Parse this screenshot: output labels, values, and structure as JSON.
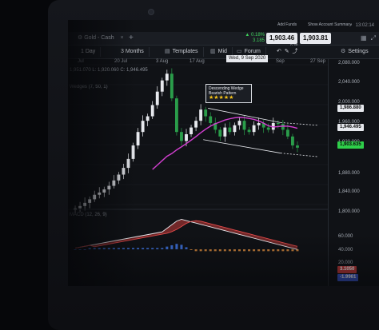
{
  "status": {
    "time": "13:02:14"
  },
  "tab": {
    "label": "Gold - Cash",
    "close": "×",
    "add": "+"
  },
  "quote": {
    "change_pct": "▲ 0.18%",
    "change_abs": "3.185",
    "bid": "1,903.46",
    "ask": "1,903.81",
    "spread": "0.35",
    "add_funds": "Add Funds",
    "summary": "Show Account Summary"
  },
  "toolbar": {
    "timeframe": "1 Day",
    "range": "3 Months",
    "templates": "Templates",
    "mid": "Mid",
    "forum": "Forum",
    "settings": "Settings"
  },
  "xaxis": {
    "labels": [
      "Jul",
      "20 Jul",
      "3 Aug",
      "17 Aug",
      "31",
      "Sep",
      "27 Sep"
    ],
    "crosshair": "Wed, 9 Sep 2020"
  },
  "legend": {
    "ohlc": "1,951.070  L: 1,920.060  C: 1,946.495",
    "indicator": "Wedges (7, 50, 1)",
    "macd": "MACD (12, 26, 9)"
  },
  "annotation": {
    "line1": "Descending Wedge",
    "line2": "Bearish Pattern",
    "stars": "★★★★★"
  },
  "yaxis": {
    "labels": [
      "2,080.000",
      "2,040.000",
      "2,000.000",
      "1,960.000",
      "1,920.000",
      "1,880.000",
      "1,840.000",
      "1,800.000"
    ],
    "tag_high": "1,986.880",
    "tag_close": "1,946.495",
    "tag_price": "1,903.635",
    "macd_labels": [
      "60.000",
      "40.000",
      "20.000"
    ],
    "macd_tag_1": "3.1050",
    "macd_tag_2": "-1.9961"
  },
  "colors": {
    "up": "#e7e9ee",
    "down": "#2a9d4a",
    "ma": "#d23fd0",
    "wedge": "#e7e9ee",
    "macd_red": "#c23a3a"
  },
  "chart_data": {
    "type": "candlestick",
    "ylim": [
      1780,
      2090
    ],
    "closes": [
      1770,
      1775,
      1782,
      1790,
      1800,
      1805,
      1812,
      1820,
      1832,
      1845,
      1860,
      1880,
      1910,
      1940,
      1965,
      1975,
      2000,
      2030,
      2055,
      2070,
      2015,
      1940,
      1920,
      1935,
      1950,
      1965,
      1990,
      1975,
      1960,
      1945,
      1930,
      1950,
      1940,
      1955,
      1965,
      1945,
      1940,
      1955,
      1960,
      1950,
      1945,
      1960,
      1958,
      1945,
      1930,
      1910,
      1905
    ]
  }
}
